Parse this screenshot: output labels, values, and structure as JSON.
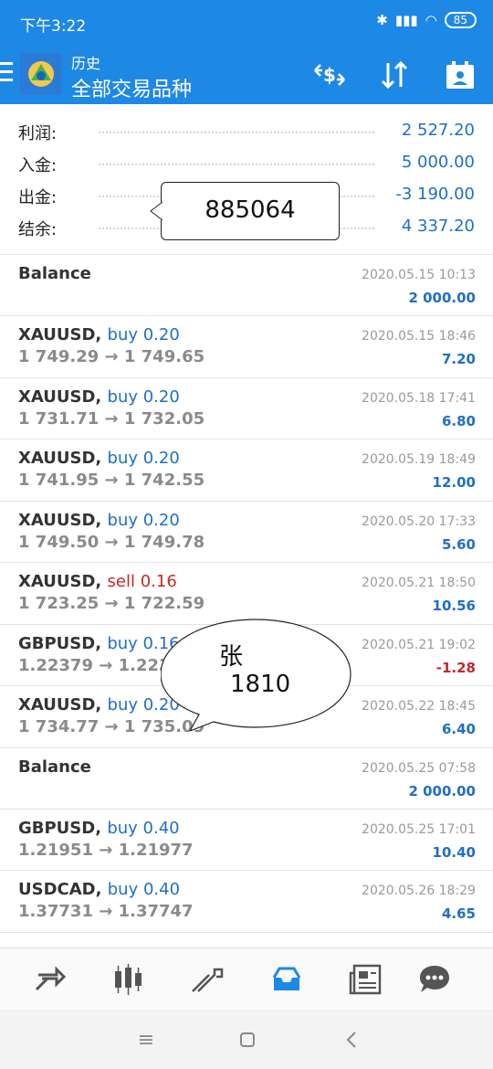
{
  "status_bar": {
    "time": "下午3:22",
    "battery": "85"
  },
  "header": {
    "title": "历史",
    "subtitle": "全部交易品种"
  },
  "summary": [
    {
      "label": "利润:",
      "value": "2 527.20"
    },
    {
      "label": "入金:",
      "value": "5 000.00"
    },
    {
      "label": "出金:",
      "value": "-3 190.00"
    },
    {
      "label": "结余:",
      "value": "4 337.20"
    }
  ],
  "annotations": {
    "account": "885064",
    "name": "张",
    "number": "1810"
  },
  "deals": [
    {
      "symbol": "Balance",
      "time": "2020.05.15 10:13",
      "profit": "2 000.00"
    },
    {
      "symbol": "XAUUSD,",
      "direction": "buy 0.20",
      "side": "buy",
      "prices": "1 749.29 → 1 749.65",
      "time": "2020.05.15 18:46",
      "profit": "7.20"
    },
    {
      "symbol": "XAUUSD,",
      "direction": "buy 0.20",
      "side": "buy",
      "prices": "1 731.71 → 1 732.05",
      "time": "2020.05.18 17:41",
      "profit": "6.80"
    },
    {
      "symbol": "XAUUSD,",
      "direction": "buy 0.20",
      "side": "buy",
      "prices": "1 741.95 → 1 742.55",
      "time": "2020.05.19 18:49",
      "profit": "12.00"
    },
    {
      "symbol": "XAUUSD,",
      "direction": "buy 0.20",
      "side": "buy",
      "prices": "1 749.50 → 1 749.78",
      "time": "2020.05.20 17:33",
      "profit": "5.60"
    },
    {
      "symbol": "XAUUSD,",
      "direction": "sell 0.16",
      "side": "sell",
      "prices": "1 723.25 → 1 722.59",
      "time": "2020.05.21 18:50",
      "profit": "10.56"
    },
    {
      "symbol": "GBPUSD,",
      "direction": "buy 0.16",
      "side": "buy",
      "prices": "1.22379 → 1.2237",
      "time": "2020.05.21 19:02",
      "profit": "-1.28"
    },
    {
      "symbol": "XAUUSD,",
      "direction": "buy 0.20",
      "side": "buy",
      "prices": "1 734.77 → 1 735.09",
      "time": "2020.05.22 18:45",
      "profit": "6.40"
    },
    {
      "symbol": "Balance",
      "time": "2020.05.25 07:58",
      "profit": "2 000.00"
    },
    {
      "symbol": "GBPUSD,",
      "direction": "buy 0.40",
      "side": "buy",
      "prices": "1.21951 → 1.21977",
      "time": "2020.05.25 17:01",
      "profit": "10.40"
    },
    {
      "symbol": "USDCAD,",
      "direction": "buy 0.40",
      "side": "buy",
      "prices": "1.37731 → 1.37747",
      "time": "2020.05.26 18:29",
      "profit": "4.65"
    }
  ],
  "icons": {
    "header": [
      "currency-exchange-icon",
      "sort-icon",
      "calendar-icon"
    ],
    "bottom_nav": [
      "quotes-icon",
      "chart-icon",
      "trade-icon",
      "history-icon",
      "news-icon",
      "chat-icon"
    ],
    "system_nav": [
      "menu-icon",
      "home-icon",
      "back-icon"
    ]
  },
  "colors": {
    "accent": "#1e88e5",
    "buy": "#1f6fc5",
    "sell": "#c62828"
  }
}
